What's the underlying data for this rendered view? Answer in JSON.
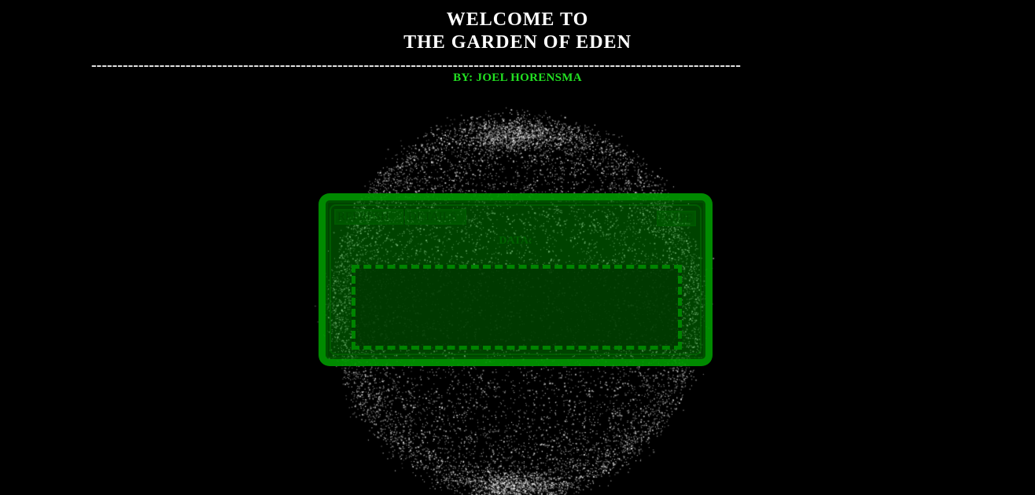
{
  "header": {
    "title_line1": "WELCOME TO",
    "title_line2": "THE GARDEN OF EDEN",
    "divider": "----------------------------------------------------------------------------------------------------------------------------",
    "byline": "BY: JOEL HORENSMA"
  },
  "panel": {
    "refresh_label": "REFRESH",
    "details_label": "DETAILS",
    "wipe_label": "WIPE",
    "data_label": "DATA:",
    "data_value": ""
  },
  "colors": {
    "background": "#000000",
    "title": "#ffffff",
    "byline": "#22e022",
    "panel_green": "#009600"
  }
}
